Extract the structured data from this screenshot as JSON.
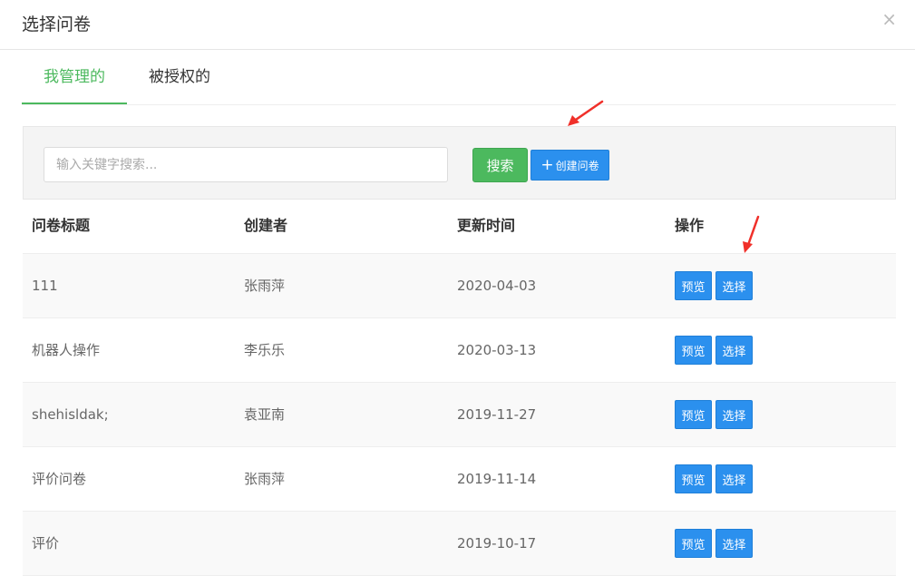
{
  "dialog": {
    "title": "选择问卷",
    "close_glyph": "×"
  },
  "tabs": [
    {
      "label": "我管理的",
      "active": true
    },
    {
      "label": "被授权的",
      "active": false
    }
  ],
  "toolbar": {
    "search_placeholder": "输入关键字搜索...",
    "search_value": "",
    "search_label": "搜索",
    "create_label": "创建问卷",
    "create_icon": "plus-icon"
  },
  "table": {
    "columns": [
      "问卷标题",
      "创建者",
      "更新时间",
      "操作"
    ],
    "rows": [
      {
        "title": "111",
        "creator": "张雨萍",
        "updated": "2020-04-03"
      },
      {
        "title": "机器人操作",
        "creator": "李乐乐",
        "updated": "2020-03-13"
      },
      {
        "title": "shehisldak;",
        "creator": "袁亚南",
        "updated": "2019-11-27"
      },
      {
        "title": "评价问卷",
        "creator": "张雨萍",
        "updated": "2019-11-14"
      },
      {
        "title": "评价",
        "creator": "",
        "updated": "2019-10-17"
      }
    ],
    "preview_label": "预览",
    "select_label": "选择"
  },
  "colors": {
    "accent_green": "#4cb95e",
    "button_blue": "#2b90ee",
    "annotation_red": "#f0302a"
  }
}
